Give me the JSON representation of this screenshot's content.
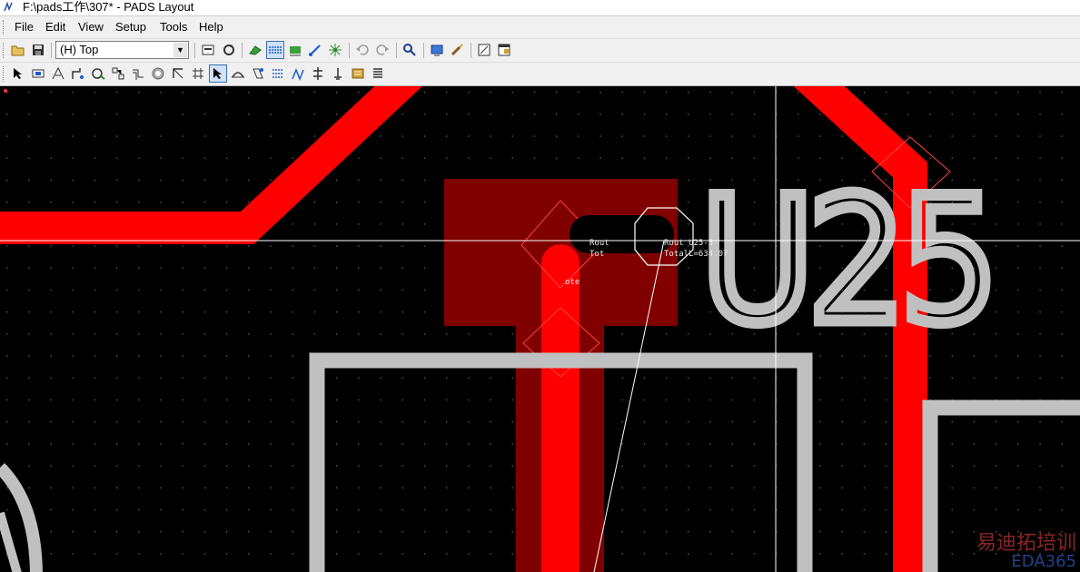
{
  "window": {
    "title": "F:\\pads工作\\307* - PADS Layout"
  },
  "menu": [
    {
      "label": "File"
    },
    {
      "label": "Edit"
    },
    {
      "label": "View"
    },
    {
      "label": "Setup"
    },
    {
      "label": "Tools"
    },
    {
      "label": "Help"
    }
  ],
  "toolbar": {
    "layer_select_value": "(H) Top",
    "buttons": [
      {
        "icon": "open-folder-icon"
      },
      {
        "icon": "save-icon"
      },
      {
        "icon": "layer-properties-icon"
      },
      {
        "icon": "redraw-icon"
      },
      {
        "icon": "drafting-toolbar-icon"
      },
      {
        "icon": "design-toolbar-icon"
      },
      {
        "icon": "dimensioning-toolbar-icon"
      },
      {
        "icon": "route-toolbar-icon"
      },
      {
        "icon": "cluster-toolbar-icon"
      },
      {
        "icon": "undo-icon"
      },
      {
        "icon": "redo-icon"
      },
      {
        "icon": "zoom-icon"
      },
      {
        "icon": "view-panel-icon"
      },
      {
        "icon": "eco-icon"
      },
      {
        "icon": "board-view-icon"
      },
      {
        "icon": "window-icon"
      }
    ]
  },
  "route_toolbar": {
    "buttons": [
      {
        "icon": "select-icon"
      },
      {
        "icon": "select-component-icon"
      },
      {
        "icon": "add-route-icon"
      },
      {
        "icon": "dynamic-route-icon"
      },
      {
        "icon": "sketch-route-icon"
      },
      {
        "icon": "auto-route-icon"
      },
      {
        "icon": "bus-route-icon"
      },
      {
        "icon": "via-icon"
      },
      {
        "icon": "length-icon"
      },
      {
        "icon": "stretch-icon"
      },
      {
        "icon": "diff-pair-icon"
      },
      {
        "icon": "trace-tune-icon"
      },
      {
        "icon": "accordion-icon"
      },
      {
        "icon": "match-length-icon"
      },
      {
        "icon": "fanout-icon"
      },
      {
        "icon": "teardrop-icon"
      },
      {
        "icon": "net-highlight-icon"
      },
      {
        "icon": "report-icon"
      }
    ]
  },
  "pcb": {
    "refdes": "U25",
    "annotation_line1": "Rout U25-5",
    "annotation_line2": "TotalL=634.07",
    "annotation_left1": "Rout",
    "annotation_left2": "Tot",
    "annotation_left3": "ote",
    "colors": {
      "background": "#000000",
      "trace": "#ff0000",
      "copper_pour": "#800000",
      "silkscreen": "#c0c0c0",
      "grid_dot": "#6a6a6a",
      "crosshair": "#ffffff"
    }
  },
  "watermark": {
    "text": "EDA365",
    "sub": "易迪拓培训"
  }
}
